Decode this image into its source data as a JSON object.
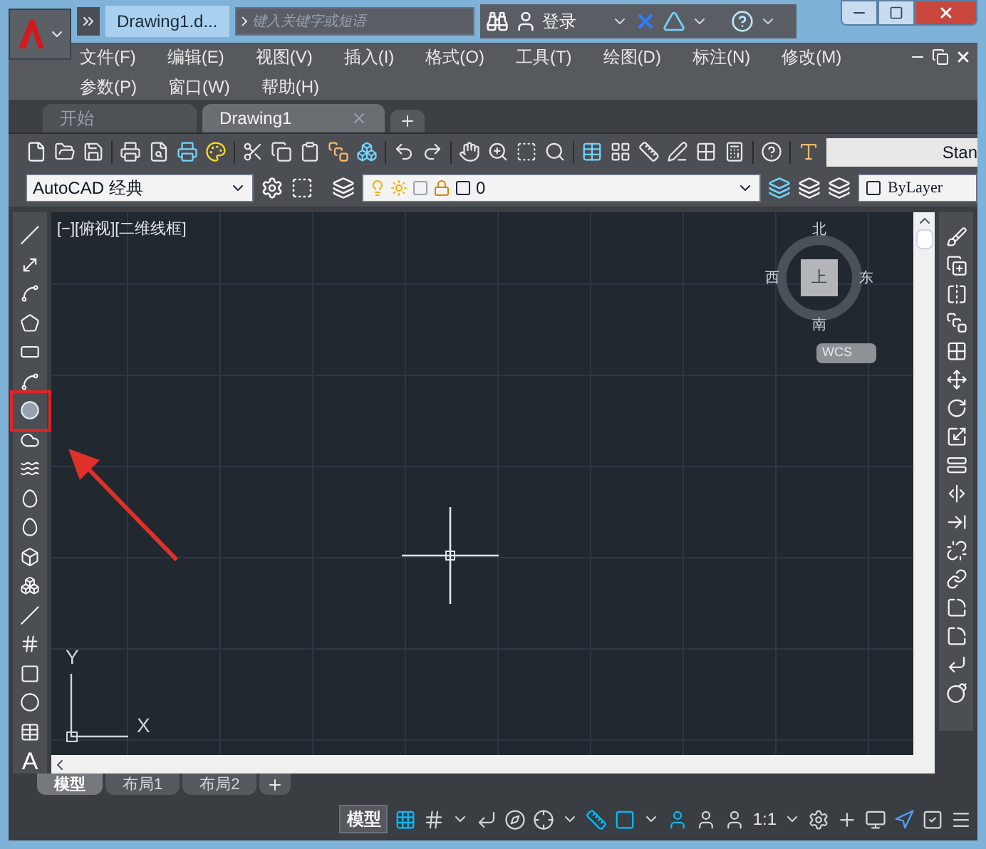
{
  "title_bar": {
    "document_tab": "Drawing1.d...",
    "search": {
      "placeholder": "键入关键字或短语"
    },
    "user": "登录"
  },
  "menu_rows": [
    [
      "文件(F)",
      "编辑(E)",
      "视图(V)",
      "插入(I)",
      "格式(O)",
      "工具(T)",
      "绘图(D)",
      "标注(N)",
      "修改(M)"
    ],
    [
      "参数(P)",
      "窗口(W)",
      "帮助(H)"
    ]
  ],
  "file_tabs": [
    {
      "label": "开始",
      "selected": false,
      "closable": false
    },
    {
      "label": "Drawing1",
      "selected": true,
      "closable": true
    }
  ],
  "standard_toolbar": {
    "text_style": "Stan"
  },
  "layers_toolbar": {
    "workspace": "AutoCAD 经典",
    "layer": "0",
    "color_control": "ByLayer"
  },
  "viewport": {
    "label": "[−][俯视][二维线框]",
    "viewcube": {
      "north": "北",
      "west": "西",
      "east": "东",
      "south": "南",
      "face": "上"
    },
    "wcs": "WCS",
    "ucs": {
      "y": "Y",
      "x": "X"
    }
  },
  "left_toolbar": [
    {
      "highlighted": false
    },
    {
      "highlighted": false
    },
    {
      "highlighted": false
    },
    {
      "highlighted": false
    },
    {
      "highlighted": false
    },
    {
      "highlighted": false
    },
    {
      "highlighted": true
    },
    {
      "highlighted": false
    },
    {
      "highlighted": false
    },
    {
      "highlighted": false
    },
    {
      "highlighted": false
    },
    {
      "highlighted": false
    },
    {
      "highlighted": false
    },
    {
      "highlighted": false
    },
    {
      "highlighted": false
    },
    {
      "highlighted": false
    },
    {
      "highlighted": false
    },
    {
      "highlighted": false
    },
    {
      "highlighted": false,
      "glyph": "A"
    }
  ],
  "layout_tabs": [
    {
      "label": "模型",
      "selected": true
    },
    {
      "label": "布局1",
      "selected": false
    },
    {
      "label": "布局2",
      "selected": false
    }
  ],
  "status_bar": {
    "space": "模型",
    "scale": "1:1"
  }
}
